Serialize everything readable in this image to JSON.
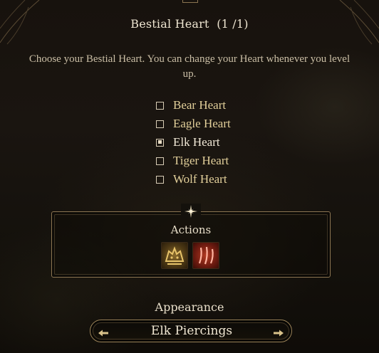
{
  "header": {
    "title": "Bestial Heart  (1 /1)"
  },
  "description": "Choose your Bestial Heart. You can change your Heart whenever you level up.",
  "options": [
    {
      "label": "Bear Heart",
      "checked": false
    },
    {
      "label": "Eagle Heart",
      "checked": false
    },
    {
      "label": "Elk Heart",
      "checked": true
    },
    {
      "label": "Tiger Heart",
      "checked": false
    },
    {
      "label": "Wolf Heart",
      "checked": false
    }
  ],
  "actions": {
    "title": "Actions",
    "icons": [
      "bear-action-icon",
      "claw-action-icon"
    ]
  },
  "appearance": {
    "label": "Appearance",
    "value": "Elk Piercings"
  },
  "colors": {
    "option_text": "#e2cf9a",
    "frame": "#8e7753"
  }
}
